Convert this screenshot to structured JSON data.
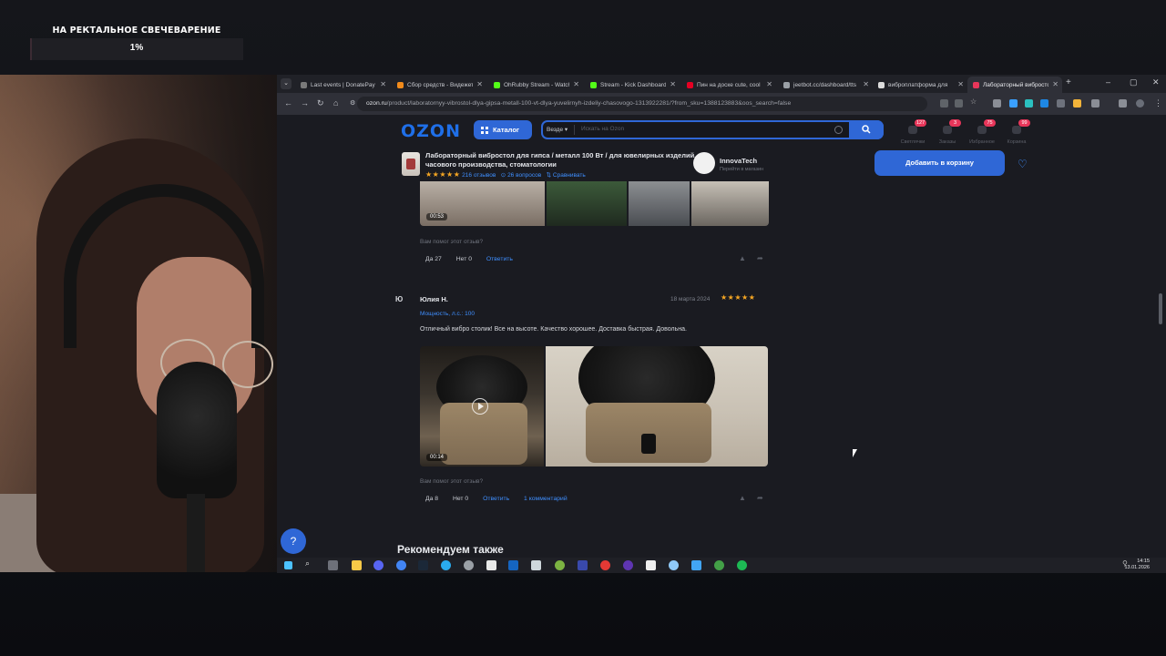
{
  "goal": {
    "title": "НА РЕКТАЛЬНОЕ СВЕЧЕВАРЕНИЕ",
    "percent_text": "1%",
    "progress_fraction": 0.01
  },
  "browser": {
    "tabs": [
      {
        "label": "Last events | DonatePay",
        "color": "#7a7a7a"
      },
      {
        "label": "Сбор средств - Видежет",
        "color": "#f28b1b"
      },
      {
        "label": "OhRubby Stream - Watch",
        "color": "#53fc18"
      },
      {
        "label": "Stream - Kick Dashboard",
        "color": "#53fc18"
      },
      {
        "label": "Пин на доске cute, cool",
        "color": "#e60023"
      },
      {
        "label": "jeetbot.cc/dashboard/tts",
        "color": "#9aa0a6"
      },
      {
        "label": "виброплатформа для",
        "color": "#dcdcdc"
      },
      {
        "label": "Лабораторный вибросто",
        "color": "#e8365a"
      }
    ],
    "url_host": "ozon.ru",
    "url_path": "/product/laboratornyy-vibrostol-dlya-gipsa-metall-100-vt-dlya-yuvelirnyh-izdeliy-chasovogo-1313922281/?from_sku=1388123883&oos_search=false"
  },
  "ozon": {
    "logo": "OZON",
    "catalog_label": "Каталог",
    "search_scope": "Везде",
    "search_placeholder": "Искать на Ozon",
    "header_icons": [
      {
        "label": "Светлячки",
        "badge": "127"
      },
      {
        "label": "Заказы",
        "badge": "3"
      },
      {
        "label": "Избранное",
        "badge": "75"
      },
      {
        "label": "Корзина",
        "badge": "99"
      }
    ],
    "product": {
      "title": "Лабораторный вибростол для гипса / металл 100 Вт / для ювелирных изделий, часового производства, стоматологии",
      "stars": "★★★★★",
      "reviews": "216 отзывов",
      "questions": "26 вопросов",
      "compare": "Сравнивать",
      "seller_name": "InnovaTech",
      "seller_link": "Перейти в магазин",
      "cart_button": "Добавить в корзину"
    },
    "review1": {
      "duration": "00:53",
      "helpful_q": "Вам помог этот отзыв?",
      "yes": "Да 27",
      "no": "Нет 0",
      "reply": "Ответить"
    },
    "review2": {
      "avatar_letter": "Ю",
      "author": "Юлия Н.",
      "date": "18 марта 2024",
      "stars": "★★★★★",
      "power": "Мощность, л.с.: 100",
      "text": "Отличный вибро столик! Все на высоте. Качество хорошее. Доставка быстрая. Довольна.",
      "duration": "00:14",
      "helpful_q": "Вам помог этот отзыв?",
      "yes": "Да 8",
      "no": "Нет 0",
      "reply": "Ответить",
      "comments": "1 комментарий"
    },
    "recommend_heading": "Рекомендуем также",
    "help_icon": "?"
  },
  "taskbar": {
    "time": "14:15",
    "date": "13.01.2026"
  }
}
